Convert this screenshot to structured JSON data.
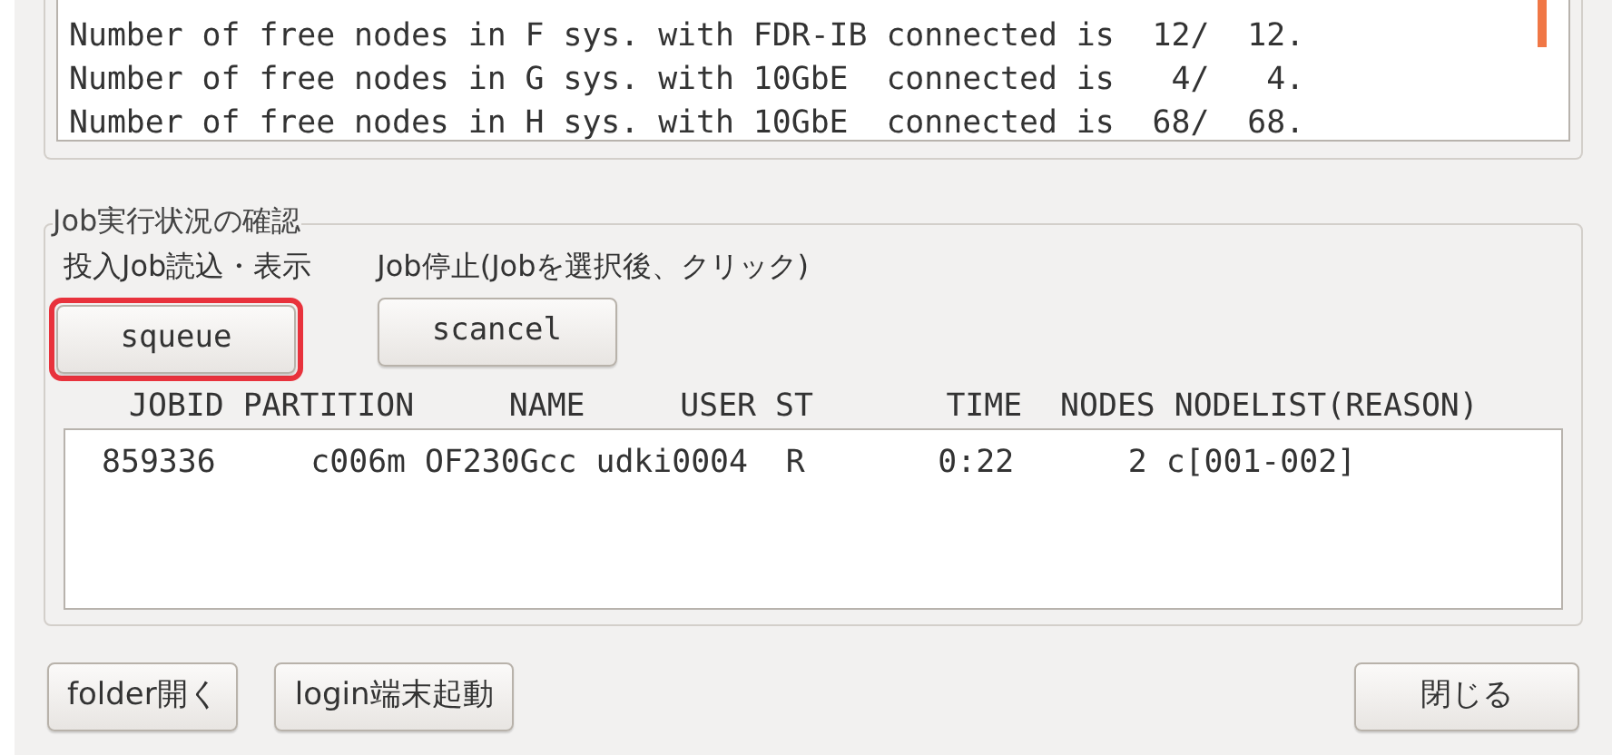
{
  "output_log": {
    "lines": [
      "Number of free nodes in F sys. with FDR-IB connected is  12/  12.",
      "Number of free nodes in G sys. with 10GbE  connected is   4/   4.",
      "Number of free nodes in H sys. with 10GbE  connected is  68/  68."
    ]
  },
  "job_status": {
    "title": "Job実行状況の確認",
    "controls": [
      {
        "label": "投入Job読込・表示",
        "button": "squeue",
        "highlighted": true
      },
      {
        "label": "Job停止(Jobを選択後、クリック)",
        "button": "scancel",
        "highlighted": false
      }
    ],
    "list_header": "JOBID PARTITION     NAME     USER ST       TIME  NODES NODELIST(REASON)",
    "rows": [
      {
        "text": "859336     c006m OF230Gcc udki0004  R       0:22      2 c[001-002]",
        "selected": false
      }
    ]
  },
  "footer_buttons": {
    "left": [
      "folder開く",
      "login端末起動"
    ],
    "right": [
      "閉じる"
    ]
  }
}
